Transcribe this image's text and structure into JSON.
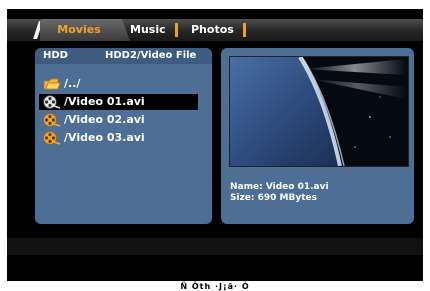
{
  "tabs": {
    "movies": "Movies",
    "music": "Music",
    "photos": "Photos"
  },
  "browser": {
    "drive": "HDD",
    "path": "HDD2/Video File",
    "items": [
      {
        "label": "/../",
        "icon": "folder-up-icon"
      },
      {
        "label": "/Video 01.avi",
        "icon": "film-reel-icon",
        "selected": true
      },
      {
        "label": "/Video 02.avi",
        "icon": "film-reel-icon"
      },
      {
        "label": "/Video 03.avi",
        "icon": "film-reel-icon"
      }
    ]
  },
  "preview": {
    "name": "Name: Video 01.avi",
    "size": "Size: 690 MBytes"
  },
  "caption": "Ñ Ôth ·J¡ã· Ó",
  "colors": {
    "accent": "#f3a126",
    "panel": "#4d6e95",
    "panel_header": "#3e5c80"
  }
}
